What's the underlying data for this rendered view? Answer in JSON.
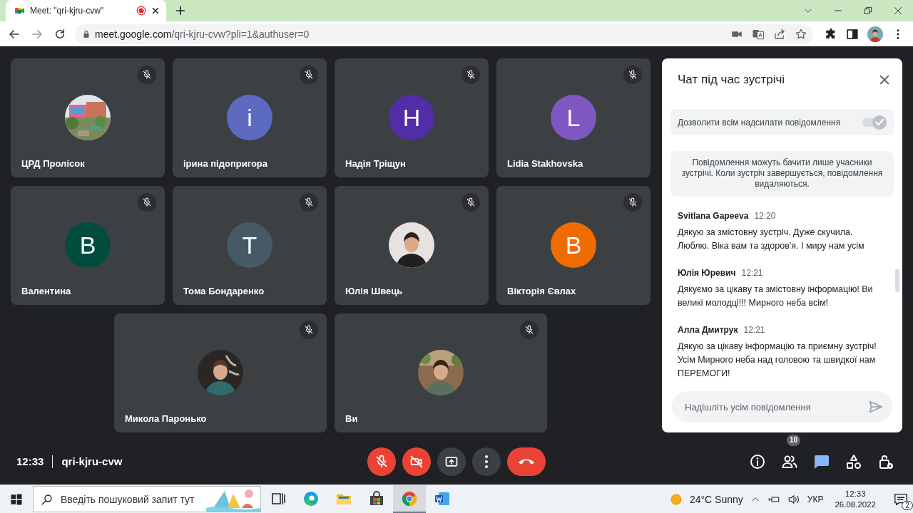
{
  "browser": {
    "tab": {
      "title": "Meet: \"qri-kjru-cvw\"",
      "recording": true
    },
    "nav": [
      {
        "kind": "back",
        "disabled": false
      },
      {
        "kind": "forward",
        "disabled": true
      },
      {
        "kind": "reload",
        "disabled": false
      }
    ],
    "url_host": "meet.google.com",
    "url_path": "/qri-kjru-cvw?pli=1&authuser=0"
  },
  "tiles": [
    {
      "name": "ЦРД Пролісок",
      "muted": true
    },
    {
      "name": "ірина підопригора",
      "muted": true,
      "avatar": {
        "kind": "letter",
        "letter": "і",
        "color": "#5c6bc0"
      }
    },
    {
      "name": "Надія Тріщун",
      "muted": true,
      "avatar": {
        "kind": "letter",
        "letter": "Н",
        "color": "#512da8"
      }
    },
    {
      "name": "Lidia Stakhovska",
      "muted": true,
      "avatar": {
        "kind": "letter",
        "letter": "L",
        "color": "#7e57c2"
      }
    },
    {
      "name": "Валентина",
      "muted": true,
      "avatar": {
        "kind": "letter",
        "letter": "В",
        "color": "#004d40"
      }
    },
    {
      "name": "Тома Бондаренко",
      "muted": true,
      "avatar": {
        "kind": "letter",
        "letter": "Т",
        "color": "#455a64"
      }
    },
    {
      "name": "Юлія Швець",
      "muted": true
    },
    {
      "name": "Вікторія Євлах",
      "muted": true,
      "avatar": {
        "kind": "letter",
        "letter": "В",
        "color": "#ef6c00"
      }
    },
    {
      "name": "Микола Паронько",
      "muted": true
    },
    {
      "name": "Ви",
      "muted": true
    }
  ],
  "chat": {
    "title": "Чат під час зустрічі",
    "allow": {
      "label": "Дозволити всім надсилати повідомлення",
      "on": true
    },
    "notice": "Повідомлення можуть бачити лише учасники зустрічі. Коли зустріч завершується, повідомлення видаляються.",
    "messages": [
      {
        "author": "Svitlana Gapeeva",
        "time": "12:20",
        "text": "Дякую за змістовну зустріч. Дуже скучила. Люблю. Віка вам та здоров'я. І миру нам усім"
      },
      {
        "author": "Юлія Юревич",
        "time": "12:21",
        "text": "Дякуємо за цікаву та змістовну інформацію! Ви великі молодці!!! Мирного неба всім!"
      },
      {
        "author": "Алла Дмитрук",
        "time": "12:21",
        "text": "Дякую за цікаву інформацію та приємну зустріч! Усім Мирного неба над головою та швидкої нам ПЕРЕМОГИ!"
      }
    ],
    "input_placeholder": "Надішліть усім повідомлення"
  },
  "meeting_bar": {
    "time": "12:33",
    "code": "qri-kjru-cvw",
    "controls": [
      {
        "kind": "mic",
        "on": false
      },
      {
        "kind": "camera",
        "on": false
      },
      {
        "kind": "present"
      },
      {
        "kind": "more"
      },
      {
        "kind": "hangup"
      }
    ],
    "side": [
      {
        "kind": "info",
        "selected": false
      },
      {
        "kind": "people",
        "badge": "10",
        "selected": false
      },
      {
        "kind": "chat",
        "selected": true
      },
      {
        "kind": "activities",
        "selected": false
      },
      {
        "kind": "host",
        "selected": false
      }
    ]
  },
  "taskbar": {
    "search_placeholder": "Введіть пошуковий запит тут",
    "apps": [
      {
        "kind": "taskview",
        "selected": false
      },
      {
        "kind": "edge",
        "selected": false
      },
      {
        "kind": "explorer",
        "selected": false
      },
      {
        "kind": "store",
        "selected": false
      },
      {
        "kind": "chrome",
        "selected": true
      },
      {
        "kind": "word",
        "selected": false
      }
    ],
    "weather": "24°C Sunny",
    "language": "УКР",
    "time": "12:33",
    "date": "26.08.2022",
    "notifications": "2"
  }
}
